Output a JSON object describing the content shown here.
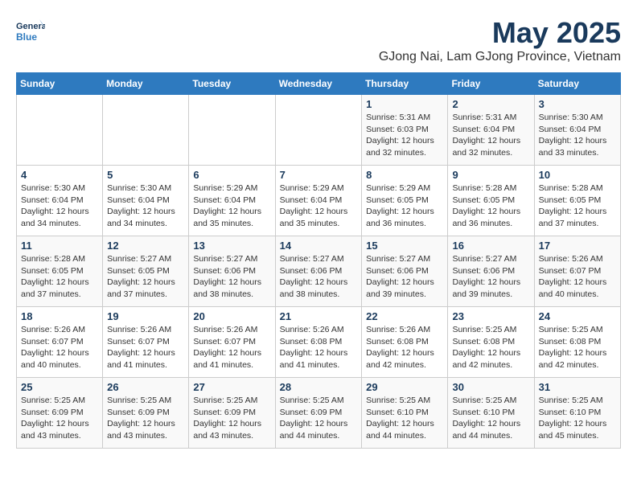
{
  "logo": {
    "text_general": "General",
    "text_blue": "Blue"
  },
  "title": "May 2025",
  "subtitle": "GJong Nai, Lam GJong Province, Vietnam",
  "weekdays": [
    "Sunday",
    "Monday",
    "Tuesday",
    "Wednesday",
    "Thursday",
    "Friday",
    "Saturday"
  ],
  "weeks": [
    [
      {
        "date": "",
        "info": ""
      },
      {
        "date": "",
        "info": ""
      },
      {
        "date": "",
        "info": ""
      },
      {
        "date": "",
        "info": ""
      },
      {
        "date": "1",
        "info": "Sunrise: 5:31 AM\nSunset: 6:03 PM\nDaylight: 12 hours\nand 32 minutes."
      },
      {
        "date": "2",
        "info": "Sunrise: 5:31 AM\nSunset: 6:04 PM\nDaylight: 12 hours\nand 32 minutes."
      },
      {
        "date": "3",
        "info": "Sunrise: 5:30 AM\nSunset: 6:04 PM\nDaylight: 12 hours\nand 33 minutes."
      }
    ],
    [
      {
        "date": "4",
        "info": "Sunrise: 5:30 AM\nSunset: 6:04 PM\nDaylight: 12 hours\nand 34 minutes."
      },
      {
        "date": "5",
        "info": "Sunrise: 5:30 AM\nSunset: 6:04 PM\nDaylight: 12 hours\nand 34 minutes."
      },
      {
        "date": "6",
        "info": "Sunrise: 5:29 AM\nSunset: 6:04 PM\nDaylight: 12 hours\nand 35 minutes."
      },
      {
        "date": "7",
        "info": "Sunrise: 5:29 AM\nSunset: 6:04 PM\nDaylight: 12 hours\nand 35 minutes."
      },
      {
        "date": "8",
        "info": "Sunrise: 5:29 AM\nSunset: 6:05 PM\nDaylight: 12 hours\nand 36 minutes."
      },
      {
        "date": "9",
        "info": "Sunrise: 5:28 AM\nSunset: 6:05 PM\nDaylight: 12 hours\nand 36 minutes."
      },
      {
        "date": "10",
        "info": "Sunrise: 5:28 AM\nSunset: 6:05 PM\nDaylight: 12 hours\nand 37 minutes."
      }
    ],
    [
      {
        "date": "11",
        "info": "Sunrise: 5:28 AM\nSunset: 6:05 PM\nDaylight: 12 hours\nand 37 minutes."
      },
      {
        "date": "12",
        "info": "Sunrise: 5:27 AM\nSunset: 6:05 PM\nDaylight: 12 hours\nand 37 minutes."
      },
      {
        "date": "13",
        "info": "Sunrise: 5:27 AM\nSunset: 6:06 PM\nDaylight: 12 hours\nand 38 minutes."
      },
      {
        "date": "14",
        "info": "Sunrise: 5:27 AM\nSunset: 6:06 PM\nDaylight: 12 hours\nand 38 minutes."
      },
      {
        "date": "15",
        "info": "Sunrise: 5:27 AM\nSunset: 6:06 PM\nDaylight: 12 hours\nand 39 minutes."
      },
      {
        "date": "16",
        "info": "Sunrise: 5:27 AM\nSunset: 6:06 PM\nDaylight: 12 hours\nand 39 minutes."
      },
      {
        "date": "17",
        "info": "Sunrise: 5:26 AM\nSunset: 6:07 PM\nDaylight: 12 hours\nand 40 minutes."
      }
    ],
    [
      {
        "date": "18",
        "info": "Sunrise: 5:26 AM\nSunset: 6:07 PM\nDaylight: 12 hours\nand 40 minutes."
      },
      {
        "date": "19",
        "info": "Sunrise: 5:26 AM\nSunset: 6:07 PM\nDaylight: 12 hours\nand 41 minutes."
      },
      {
        "date": "20",
        "info": "Sunrise: 5:26 AM\nSunset: 6:07 PM\nDaylight: 12 hours\nand 41 minutes."
      },
      {
        "date": "21",
        "info": "Sunrise: 5:26 AM\nSunset: 6:08 PM\nDaylight: 12 hours\nand 41 minutes."
      },
      {
        "date": "22",
        "info": "Sunrise: 5:26 AM\nSunset: 6:08 PM\nDaylight: 12 hours\nand 42 minutes."
      },
      {
        "date": "23",
        "info": "Sunrise: 5:25 AM\nSunset: 6:08 PM\nDaylight: 12 hours\nand 42 minutes."
      },
      {
        "date": "24",
        "info": "Sunrise: 5:25 AM\nSunset: 6:08 PM\nDaylight: 12 hours\nand 42 minutes."
      }
    ],
    [
      {
        "date": "25",
        "info": "Sunrise: 5:25 AM\nSunset: 6:09 PM\nDaylight: 12 hours\nand 43 minutes."
      },
      {
        "date": "26",
        "info": "Sunrise: 5:25 AM\nSunset: 6:09 PM\nDaylight: 12 hours\nand 43 minutes."
      },
      {
        "date": "27",
        "info": "Sunrise: 5:25 AM\nSunset: 6:09 PM\nDaylight: 12 hours\nand 43 minutes."
      },
      {
        "date": "28",
        "info": "Sunrise: 5:25 AM\nSunset: 6:09 PM\nDaylight: 12 hours\nand 44 minutes."
      },
      {
        "date": "29",
        "info": "Sunrise: 5:25 AM\nSunset: 6:10 PM\nDaylight: 12 hours\nand 44 minutes."
      },
      {
        "date": "30",
        "info": "Sunrise: 5:25 AM\nSunset: 6:10 PM\nDaylight: 12 hours\nand 44 minutes."
      },
      {
        "date": "31",
        "info": "Sunrise: 5:25 AM\nSunset: 6:10 PM\nDaylight: 12 hours\nand 45 minutes."
      }
    ]
  ]
}
